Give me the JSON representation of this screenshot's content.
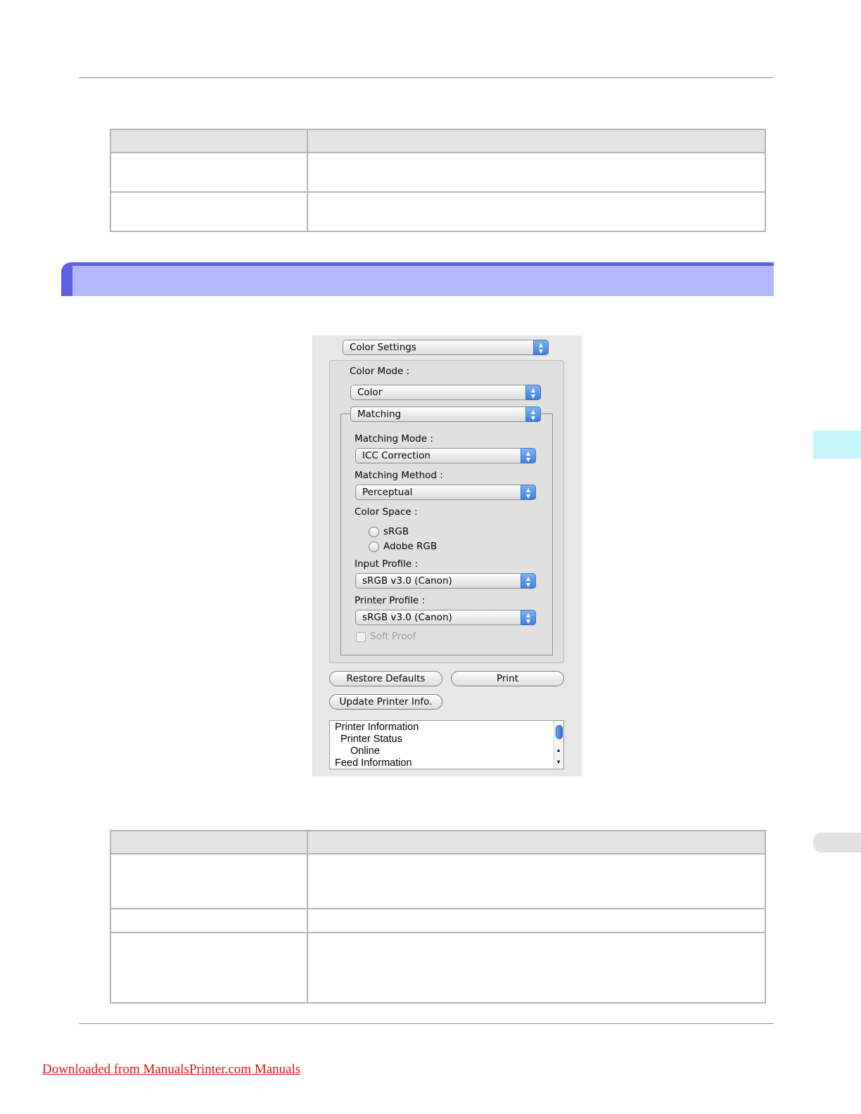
{
  "dialog": {
    "panel_popup": "Color Settings",
    "color_mode_label": "Color Mode :",
    "color_mode_value": "Color",
    "section_popup": "Matching",
    "matching_mode_label": "Matching Mode :",
    "matching_mode_value": "ICC Correction",
    "matching_method_label": "Matching Method :",
    "matching_method_value": "Perceptual",
    "color_space_label": "Color Space :",
    "color_space_options": [
      "sRGB",
      "Adobe RGB"
    ],
    "input_profile_label": "Input Profile :",
    "input_profile_value": "sRGB v3.0 (Canon)",
    "printer_profile_label": "Printer Profile :",
    "printer_profile_value": "sRGB v3.0 (Canon)",
    "soft_proof_label": "Soft Proof",
    "restore_defaults_label": "Restore Defaults",
    "print_label": "Print",
    "update_printer_info_label": "Update Printer Info.",
    "info_lines": [
      "Printer Information",
      "Printer Status",
      "Online",
      "Feed Information"
    ]
  },
  "footer": {
    "link_text": "Downloaded from ManualsPrinter.com Manuals"
  }
}
